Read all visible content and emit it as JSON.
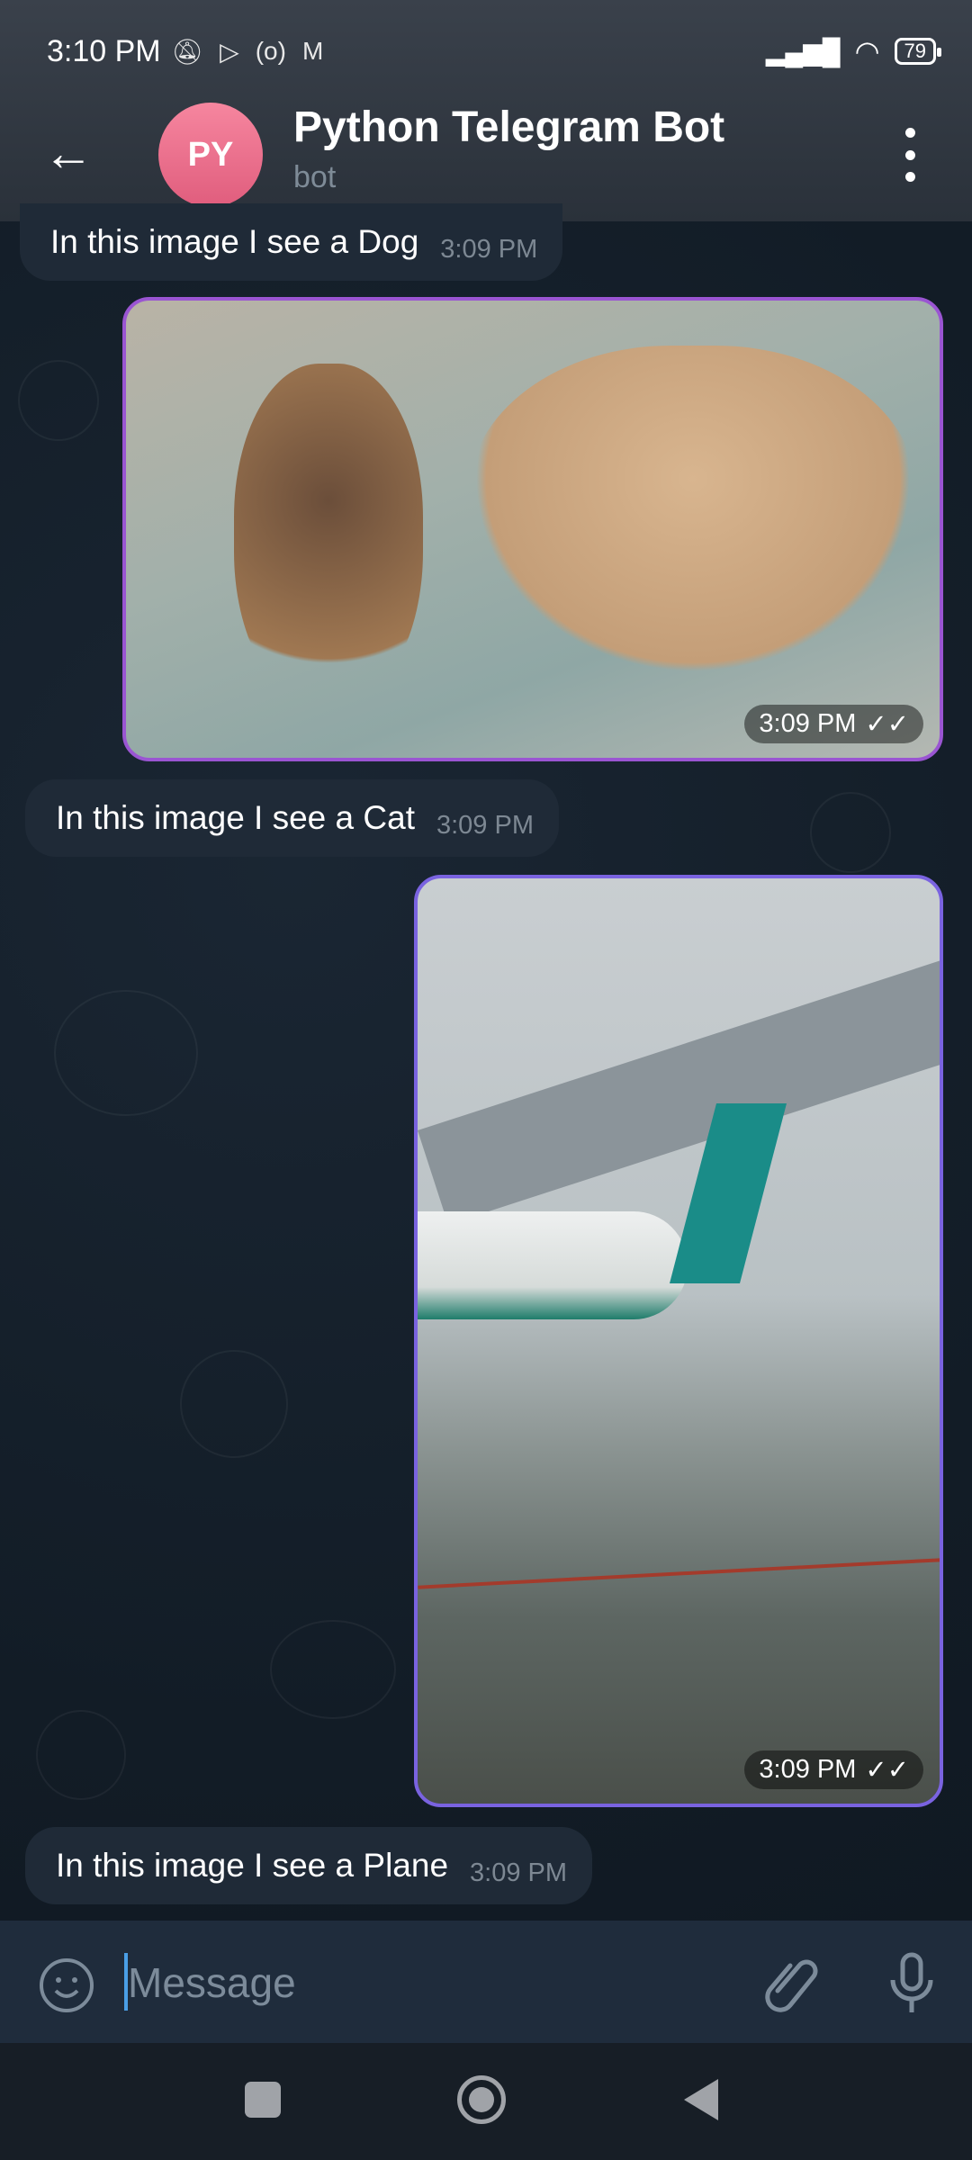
{
  "status_bar": {
    "time": "3:10 PM",
    "battery": "79",
    "icons": [
      "bell-off-icon",
      "play-icon",
      "hotspot-icon",
      "gmail-icon",
      "signal-icon",
      "wifi-icon",
      "battery-icon"
    ]
  },
  "header": {
    "avatar_initials": "PY",
    "title": "Python Telegram Bot",
    "subtitle": "bot"
  },
  "messages": [
    {
      "type": "text",
      "text": "In this image I see a Dog",
      "time": "3:09 PM"
    },
    {
      "type": "photo",
      "subject": "dogs",
      "time": "3:09 PM"
    },
    {
      "type": "text",
      "text": "In this image I see a Cat",
      "time": "3:09 PM"
    },
    {
      "type": "photo",
      "subject": "plane",
      "time": "3:09 PM"
    },
    {
      "type": "text",
      "text": "In this image I see a Plane",
      "time": "3:09 PM"
    }
  ],
  "composer": {
    "placeholder": "Message"
  },
  "colors": {
    "accent": "#9a55d2",
    "avatar": "#e9708d",
    "caret": "#4a9fe6"
  }
}
